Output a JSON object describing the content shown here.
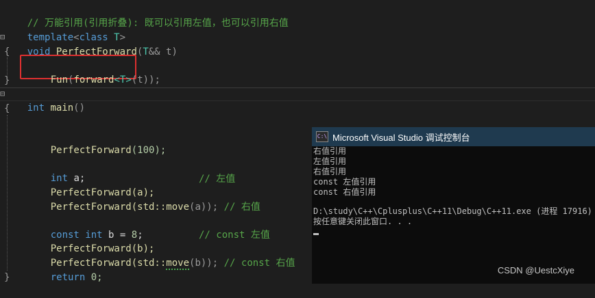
{
  "editor": {
    "comment_line": "// 万能引用(引用折叠): 既可以引用左值，也可以引用右值",
    "template_kw": "template",
    "template_open": "<",
    "class_kw": "class",
    "template_param": " T",
    "template_close": ">",
    "void_kw": "void",
    "perfect_forward_name": " PerfectForward",
    "pf_signature_open": "(",
    "pf_param_type": "T",
    "pf_param_rest": "&& ",
    "pf_param_name": "t",
    "pf_signature_close": ")",
    "open_brace": "{",
    "close_brace": "}",
    "fun_call": "Fun",
    "fun_open": "(",
    "forward_name": "forward",
    "forward_tpl": "<T>",
    "forward_arg": "(t)",
    "fun_close": ");",
    "int_kw": "int",
    "main_name": " main",
    "main_parens": "()",
    "call1_name": "PerfectForward",
    "call1_args": "(100);",
    "int_a_kw": "int",
    "int_a_rest": " a;",
    "call2": "PerfectForward(a);",
    "call2_comment": "// 左值",
    "call3_name": "PerfectForward(std::",
    "call3_move": "move",
    "call3_rest": "(a));",
    "call3_comment": "// 右值",
    "const_kw": "const",
    "const_int_kw": " int",
    "const_b_rest": " b = ",
    "const_b_val": "8",
    "const_b_end": ";",
    "call4": "PerfectForward(b);",
    "call4_comment": "// const 左值",
    "call5_name": "PerfectForward(std::",
    "call5_move": "move",
    "call5_rest": "(b));",
    "call5_comment": "// const 右值",
    "return_kw": "return",
    "return_val": " 0;"
  },
  "console": {
    "title": "Microsoft Visual Studio 调试控制台",
    "icon_label": "C:\\",
    "lines": [
      "右值引用",
      "左值引用",
      "右值引用",
      "const 左值引用",
      "const 右值引用"
    ],
    "path_line": "D:\\study\\C++\\Cplusplus\\C++11\\Debug\\C++11.exe (进程 17916)",
    "prompt_line": "按任意键关闭此窗口. . ."
  },
  "watermark": "CSDN @UestcXiye",
  "colors": {
    "keyword": "#569cd6",
    "type": "#4ec9b0",
    "comment": "#57a64a",
    "number": "#b5cea8",
    "highlight_box": "#e03030",
    "console_titlebar": "#1f3a4f"
  }
}
